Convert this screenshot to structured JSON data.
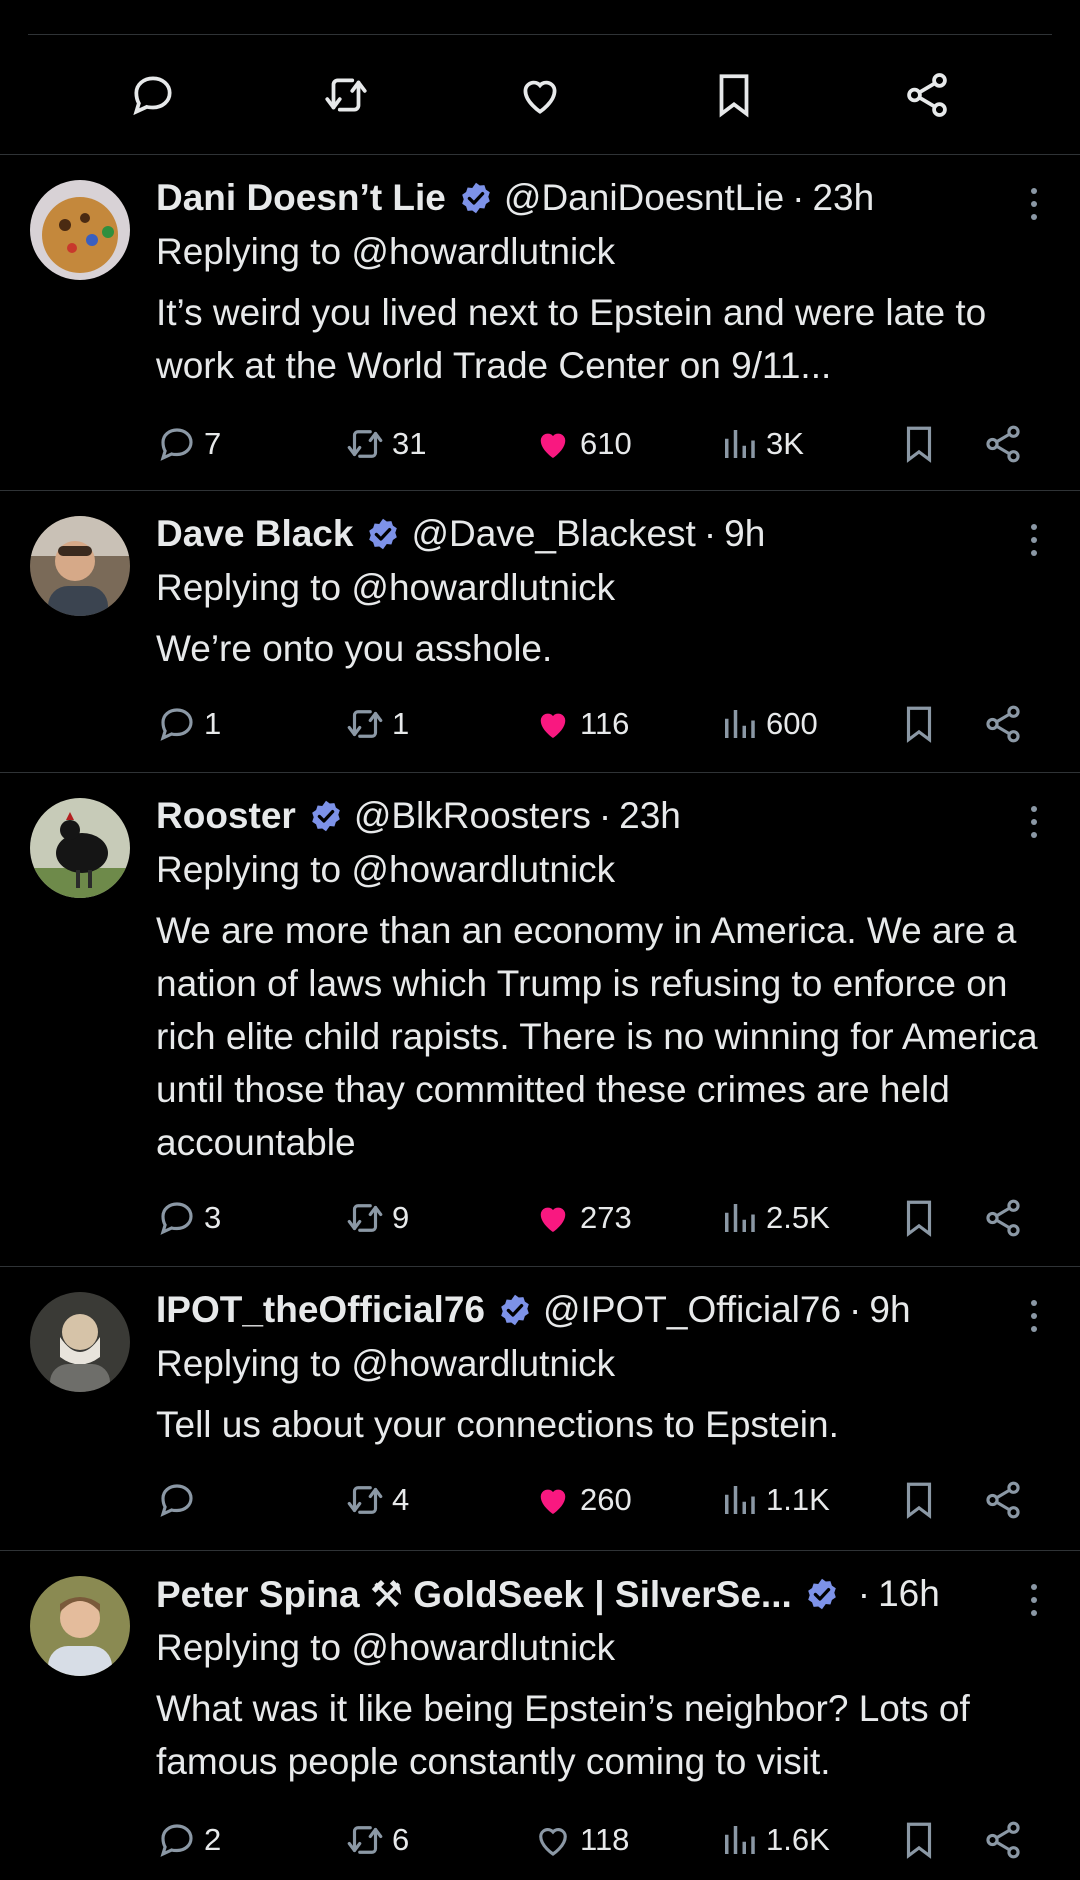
{
  "colors": {
    "background": "#000000",
    "text": "#e7e9ea",
    "muted": "#8b98a5",
    "like": "#f91880",
    "verified": "#1d9bf0",
    "divider": "#2f3336"
  },
  "top_actions": [
    "reply-icon",
    "retweet-icon",
    "like-icon",
    "bookmark-icon",
    "share-icon"
  ],
  "tweets": [
    {
      "name": "Dani Doesn’t Lie",
      "handle": "@DaniDoesntLie",
      "dot": "·",
      "time": "23h",
      "replying": "Replying to @howardlutnick",
      "text": "It’s weird you lived next to Epstein and were late to work at the World Trade Center on 9/11...",
      "replies": "7",
      "retweets": "31",
      "likes": "610",
      "views": "3K",
      "liked": true
    },
    {
      "name": "Dave Black",
      "handle": "@Dave_Blackest",
      "dot": "·",
      "time": "9h",
      "replying": "Replying to @howardlutnick",
      "text": "We’re onto you asshole.",
      "replies": "1",
      "retweets": "1",
      "likes": "116",
      "views": "600",
      "liked": true
    },
    {
      "name": "Rooster",
      "handle": "@BlkRoosters",
      "dot": "·",
      "time": "23h",
      "replying": "Replying to @howardlutnick",
      "text": "We are more than an economy in America. We are a nation of laws which Trump is refusing to enforce on rich elite child rapists. There is no winning for America until those thay committed these crimes are held accountable",
      "replies": "3",
      "retweets": "9",
      "likes": "273",
      "views": "2.5K",
      "liked": true
    },
    {
      "name": "IPOT_theOfficial76",
      "handle": "@IPOT_Official76",
      "dot": "·",
      "time": "9h",
      "replying": "Replying to @howardlutnick",
      "text": "Tell us about your connections to Epstein.",
      "replies": "",
      "retweets": "4",
      "likes": "260",
      "views": "1.1K",
      "liked": true
    },
    {
      "name": "Peter Spina ⚒ GoldSeek | SilverSe...",
      "handle": "",
      "dot": "·",
      "time": "16h",
      "replying": "Replying to @howardlutnick",
      "text": "What was it like being Epstein’s neighbor? Lots of famous people constantly coming to visit.",
      "replies": "2",
      "retweets": "6",
      "likes": "118",
      "views": "1.6K",
      "liked": false
    }
  ]
}
